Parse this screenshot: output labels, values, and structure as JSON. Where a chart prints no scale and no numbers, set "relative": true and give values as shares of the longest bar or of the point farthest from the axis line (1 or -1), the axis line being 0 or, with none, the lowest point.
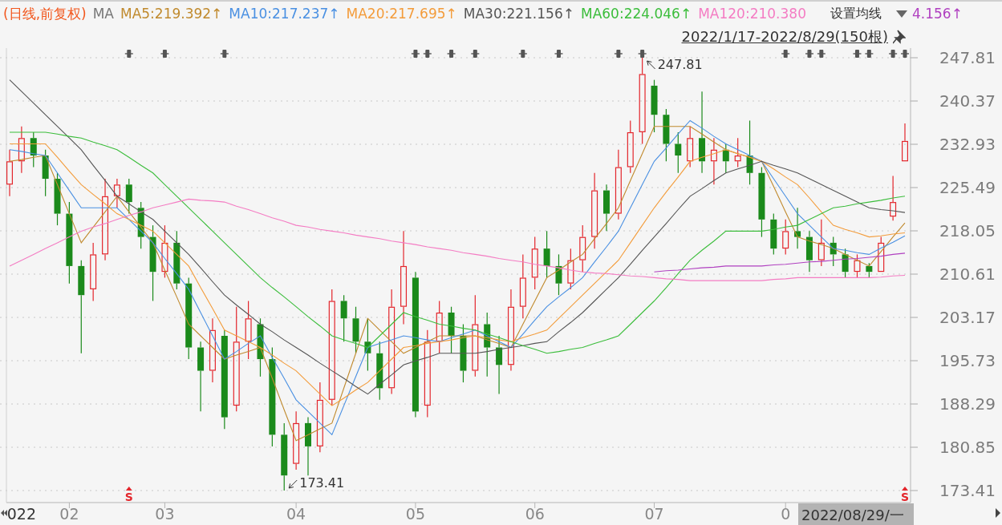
{
  "header": {
    "mode": "(日线,前复权)",
    "indicator": "MA",
    "items": [
      {
        "text": "MA5:219.392↑",
        "color": "#c08a2e"
      },
      {
        "text": "MA10:217.237↑",
        "color": "#4a90e2"
      },
      {
        "text": "MA20:217.695↑",
        "color": "#f39c3b"
      },
      {
        "text": "MA30:221.156↑",
        "color": "#555555"
      },
      {
        "text": "MA60:224.046↑",
        "color": "#3bbd3b"
      },
      {
        "text": "MA120:210.380",
        "color": "#f47cc3"
      }
    ],
    "settings": "设置均线",
    "extra_item": {
      "text": "4.156↑",
      "color": "#b040c0"
    },
    "range": "2022/1/17-2022/8/29(150根)"
  },
  "chart": {
    "chart_data": {
      "type": "candlestick",
      "grid": true,
      "categories": [
        null,
        "022",
        null,
        null,
        null,
        "02",
        null,
        null,
        null,
        null,
        null,
        null,
        null,
        "03",
        null,
        null,
        null,
        null,
        null,
        null,
        null,
        null,
        null,
        null,
        "04",
        null,
        null,
        null,
        null,
        null,
        null,
        null,
        null,
        null,
        "05",
        null,
        null,
        null,
        null,
        null,
        null,
        null,
        null,
        null,
        "06",
        null,
        null,
        null,
        null,
        null,
        null,
        null,
        null,
        null,
        "07",
        null,
        null,
        null,
        null,
        null,
        null,
        null,
        null,
        null,
        null,
        "0",
        null,
        null,
        null,
        null,
        null,
        null,
        null,
        null,
        null,
        null
      ],
      "ohlc": [
        [
          226,
          232,
          224,
          230
        ],
        [
          230,
          236,
          228,
          234
        ],
        [
          234,
          235,
          229,
          231
        ],
        [
          231,
          232,
          224,
          227
        ],
        [
          227,
          228,
          219,
          221
        ],
        [
          221,
          223,
          209,
          212
        ],
        [
          212,
          213,
          197,
          207
        ],
        [
          208,
          216,
          206,
          214
        ],
        [
          214,
          227,
          213,
          224
        ],
        [
          224,
          227,
          222,
          226
        ],
        [
          226,
          227,
          221,
          223
        ],
        [
          222,
          223,
          215,
          217
        ],
        [
          217,
          219,
          206,
          211
        ],
        [
          211,
          219,
          210,
          216
        ],
        [
          216,
          218,
          208,
          209
        ],
        [
          209,
          210,
          196,
          198
        ],
        [
          198,
          199,
          187,
          194
        ],
        [
          194,
          203,
          192,
          201
        ],
        [
          200,
          201,
          184,
          186
        ],
        [
          188,
          205,
          187,
          199
        ],
        [
          199,
          206,
          196,
          203
        ],
        [
          202,
          203,
          193,
          196
        ],
        [
          196,
          198,
          181,
          183
        ],
        [
          183,
          185,
          173.41,
          176
        ],
        [
          178,
          187,
          177,
          185
        ],
        [
          185,
          186,
          176,
          181
        ],
        [
          181,
          192,
          180,
          189
        ],
        [
          189,
          208,
          188,
          206
        ],
        [
          206,
          207,
          199,
          203
        ],
        [
          203,
          205,
          197,
          199
        ],
        [
          199,
          203,
          194,
          197
        ],
        [
          197,
          199,
          189,
          191
        ],
        [
          191,
          208,
          190,
          205
        ],
        [
          205,
          218,
          202,
          212
        ],
        [
          210,
          211,
          186,
          187
        ],
        [
          188,
          201,
          186,
          199
        ],
        [
          199,
          206,
          197,
          204
        ],
        [
          204,
          205,
          197,
          200
        ],
        [
          200,
          202,
          192,
          194
        ],
        [
          194,
          207,
          193,
          202
        ],
        [
          202,
          204,
          193,
          198
        ],
        [
          198,
          200,
          190,
          195
        ],
        [
          195,
          208,
          194,
          205
        ],
        [
          205,
          214,
          203,
          210
        ],
        [
          210,
          217,
          208,
          215
        ],
        [
          215,
          218,
          210,
          212
        ],
        [
          212,
          214,
          207,
          209
        ],
        [
          209,
          215,
          208,
          213
        ],
        [
          213,
          219,
          211,
          217
        ],
        [
          217,
          228,
          215,
          225
        ],
        [
          225,
          226,
          218,
          221
        ],
        [
          221,
          232,
          220,
          229
        ],
        [
          229,
          237,
          228,
          235
        ],
        [
          235,
          247.81,
          233,
          245
        ],
        [
          243,
          244,
          235,
          238
        ],
        [
          238,
          239,
          230,
          233
        ],
        [
          233,
          235,
          228,
          231
        ],
        [
          230,
          236,
          229,
          234
        ],
        [
          234,
          242,
          228,
          230
        ],
        [
          230,
          234,
          226,
          232
        ],
        [
          232,
          233,
          228,
          230
        ],
        [
          230,
          234,
          229,
          231
        ],
        [
          231,
          237,
          226,
          228
        ],
        [
          228,
          229,
          217,
          220
        ],
        [
          220,
          221,
          214,
          215
        ],
        [
          215,
          220,
          214,
          218
        ],
        [
          218,
          222,
          215,
          217
        ],
        [
          217,
          218,
          211,
          213
        ],
        [
          213,
          220,
          212,
          216
        ],
        [
          216,
          217,
          212,
          214
        ],
        [
          214,
          215,
          210,
          211
        ],
        [
          211,
          214,
          210,
          213
        ],
        [
          212,
          212.5,
          210,
          211
        ],
        [
          211,
          217,
          211,
          216
        ],
        [
          220.5,
          227.5,
          219.8,
          223
        ],
        [
          230,
          236.5,
          230,
          233.5
        ]
      ],
      "ylim": [
        173.41,
        247.81
      ],
      "yticks": [
        247.81,
        240.37,
        232.93,
        225.49,
        218.05,
        210.61,
        203.17,
        195.73,
        188.29,
        180.85,
        173.41
      ],
      "annotations": [
        "247.81",
        "173.41"
      ]
    },
    "ma_overlay": {
      "chart_data": {
        "type": "line",
        "relative": true,
        "series": [
          {
            "color": "#c08a2e",
            "values": [
              230,
              230.3,
              230.7,
              231,
              226,
              221,
              216,
              218.7,
              221.3,
              224,
              221.3,
              218.7,
              216,
              211.3,
              206.7,
              202,
              200,
              198,
              196,
              196.7,
              197.3,
              198,
              192.7,
              187.3,
              182,
              183,
              184,
              185,
              191,
              197,
              203,
              201,
              199,
              197,
              198,
              199,
              200,
              200,
              200,
              200,
              199.3,
              198.7,
              198,
              202,
              206,
              210,
              211.3,
              212.7,
              214,
              216.7,
              219.3,
              222,
              226.7,
              231.3,
              236,
              236,
              236,
              236,
              234.7,
              233.3,
              232,
              231.3,
              230.7,
              230,
              225.7,
              221.3,
              217,
              216.3,
              215.7,
              215,
              214,
              213,
              212,
              214.5,
              217,
              219.4
            ]
          },
          {
            "color": "#4a90e2",
            "values": [
              232,
              231.7,
              231.3,
              231,
              228,
              225,
              222,
              222,
              222,
              222,
              220,
              218,
              216,
              213.3,
              210.7,
              208,
              204,
              200,
              196,
              197.3,
              198.7,
              200,
              196.3,
              192.7,
              189,
              187,
              185,
              183,
              188,
              193,
              198,
              198.7,
              199.3,
              200,
              199.7,
              199.3,
              199,
              199.7,
              200.3,
              201,
              200,
              199,
              198,
              200.3,
              202.7,
              205,
              206.7,
              208.3,
              210,
              212.7,
              215.3,
              218,
              222,
              226,
              230,
              232.3,
              234.7,
              237,
              235.7,
              234.3,
              233,
              232,
              231,
              230,
              227,
              224,
              221,
              219,
              217,
              215,
              214.7,
              214.3,
              214,
              215.1,
              216.1,
              217.2
            ]
          },
          {
            "color": "#f39c3b",
            "values": [
              233,
              233,
              233,
              233,
              230.7,
              228.3,
              226,
              224.3,
              222.7,
              221,
              220,
              219,
              218,
              216,
              214,
              212,
              208.3,
              204.7,
              201,
              200,
              199,
              198,
              196.7,
              195.3,
              194,
              192,
              190,
              188,
              189.3,
              190.7,
              192,
              194,
              196,
              198,
              198.3,
              198.7,
              199,
              199.3,
              199.7,
              200,
              199.7,
              199.3,
              199,
              199.7,
              200.3,
              201,
              203,
              205,
              207,
              209,
              211,
              213,
              216,
              219,
              222,
              224.7,
              227.3,
              230,
              230.7,
              231.3,
              232,
              231.3,
              230.7,
              230,
              228.7,
              227.3,
              226,
              223.7,
              221.3,
              219,
              218.3,
              217.7,
              217,
              217.2,
              217.5,
              217.7
            ]
          },
          {
            "color": "#555555",
            "values": [
              244,
              242,
              240,
              238,
              236,
              234,
              232,
              229.3,
              226.7,
              224,
              222.7,
              221.3,
              220,
              218,
              216,
              214,
              211.7,
              209.3,
              207,
              205.3,
              203.7,
              202,
              200.7,
              199.3,
              198,
              196.7,
              195.3,
              194,
              192.7,
              191.3,
              190,
              191.7,
              193.3,
              195,
              195.7,
              196.3,
              197,
              197,
              197,
              197,
              197.3,
              197.7,
              198,
              198.3,
              198.7,
              199,
              200.7,
              202.3,
              204,
              206,
              208,
              210,
              212.3,
              214.7,
              217,
              219.3,
              221.7,
              224,
              225.3,
              226.7,
              228,
              228.7,
              229.3,
              230,
              229.3,
              228.7,
              228,
              227,
              226,
              225,
              224,
              223,
              222,
              221.7,
              221.5,
              221.2
            ]
          },
          {
            "color": "#3bbd3b",
            "values": [
              235,
              235,
              235,
              235,
              234.7,
              234.3,
              234,
              233.3,
              232.7,
              232,
              230.7,
              229.3,
              228,
              226,
              224,
              222,
              220,
              218,
              216,
              214,
              212,
              210,
              208.3,
              206.7,
              205,
              203.3,
              201.7,
              200,
              199.3,
              198.7,
              198,
              200,
              202,
              204,
              203.3,
              202.7,
              202,
              201.7,
              201.3,
              201,
              200.3,
              199.7,
              199,
              198.3,
              197.7,
              197,
              197.3,
              197.7,
              198,
              198.7,
              199.3,
              200,
              202,
              204,
              206,
              208.3,
              210.7,
              213,
              214.7,
              216.3,
              218,
              218,
              218,
              218,
              218.3,
              218.7,
              219,
              220,
              221,
              222,
              222.3,
              222.7,
              223,
              223.3,
              223.7,
              224
            ]
          },
          {
            "color": "#f47cc3",
            "values": [
              212,
              213,
              214,
              215,
              216,
              217,
              218,
              218.7,
              219.3,
              220,
              220.7,
              221.3,
              222,
              222.5,
              223,
              223.5,
              223.3,
              223.2,
              223,
              222.3,
              221.7,
              221,
              220.3,
              219.7,
              219,
              218.7,
              218.3,
              218,
              217.7,
              217.3,
              217,
              216.7,
              216.3,
              216,
              215.7,
              215.3,
              215,
              214.7,
              214.3,
              214,
              213.7,
              213.3,
              213,
              212.7,
              212.3,
              212,
              211.7,
              211.3,
              211,
              210.8,
              210.7,
              210.5,
              210.3,
              210.2,
              210,
              209.8,
              209.7,
              209.5,
              209.5,
              209.5,
              209.5,
              209.5,
              209.5,
              209.5,
              209.7,
              209.8,
              210,
              210,
              210,
              210,
              210,
              210,
              210,
              210.1,
              210.3,
              210.4
            ]
          },
          {
            "color": "#b040c0",
            "values": [
              null,
              null,
              null,
              null,
              null,
              null,
              null,
              null,
              null,
              null,
              null,
              null,
              null,
              null,
              null,
              null,
              null,
              null,
              null,
              null,
              null,
              null,
              null,
              null,
              null,
              null,
              null,
              null,
              null,
              null,
              null,
              null,
              null,
              null,
              null,
              null,
              null,
              null,
              null,
              null,
              null,
              null,
              null,
              null,
              null,
              null,
              null,
              null,
              null,
              null,
              null,
              null,
              null,
              null,
              211,
              211.2,
              211.3,
              211.5,
              211.7,
              211.8,
              212,
              212,
              212,
              212,
              212.2,
              212.3,
              212.5,
              212.7,
              212.8,
              213,
              213.2,
              213.3,
              213.5,
              213.7,
              214,
              214.2
            ]
          }
        ],
        "ylim": [
          173.41,
          247.81
        ]
      }
    },
    "candles": [
      {
        "event": false
      },
      {
        "event": false
      },
      {
        "event": false
      },
      {
        "event": false
      },
      {
        "event": false
      },
      {
        "event": false
      },
      {
        "event": false
      },
      {
        "event": false
      },
      {
        "event": false
      },
      {
        "event": false
      },
      {
        "event": true,
        "signal": "S"
      },
      {
        "event": false
      },
      {
        "event": false
      },
      {
        "event": true
      },
      {
        "event": false
      },
      {
        "event": false
      },
      {
        "event": false
      },
      {
        "event": false
      },
      {
        "event": true
      },
      {
        "event": false
      },
      {
        "event": false
      },
      {
        "event": false
      },
      {
        "event": false
      },
      {
        "event": false
      },
      {
        "event": false
      },
      {
        "event": false
      },
      {
        "event": false
      },
      {
        "event": false
      },
      {
        "event": false
      },
      {
        "event": false
      },
      {
        "event": false
      },
      {
        "event": false
      },
      {
        "event": false
      },
      {
        "event": false
      },
      {
        "event": true
      },
      {
        "event": true
      },
      {
        "event": false
      },
      {
        "event": true
      },
      {
        "event": false
      },
      {
        "event": true
      },
      {
        "event": false
      },
      {
        "event": false
      },
      {
        "event": false
      },
      {
        "event": true
      },
      {
        "event": false
      },
      {
        "event": false
      },
      {
        "event": true
      },
      {
        "event": false
      },
      {
        "event": false
      },
      {
        "event": false
      },
      {
        "event": false
      },
      {
        "event": true
      },
      {
        "event": false
      },
      {
        "event": true
      },
      {
        "event": false
      },
      {
        "event": false
      },
      {
        "event": false
      },
      {
        "event": false
      },
      {
        "event": false
      },
      {
        "event": false
      },
      {
        "event": false
      },
      {
        "event": false
      },
      {
        "event": false
      },
      {
        "event": false
      },
      {
        "event": false
      },
      {
        "event": true
      },
      {
        "event": false
      },
      {
        "event": true
      },
      {
        "event": true
      },
      {
        "event": false
      },
      {
        "event": false
      },
      {
        "event": true
      },
      {
        "event": true
      },
      {
        "event": false
      },
      {
        "event": true
      },
      {
        "event": true,
        "signal": "S"
      }
    ],
    "cursor_date": "2022/08/29/一"
  }
}
